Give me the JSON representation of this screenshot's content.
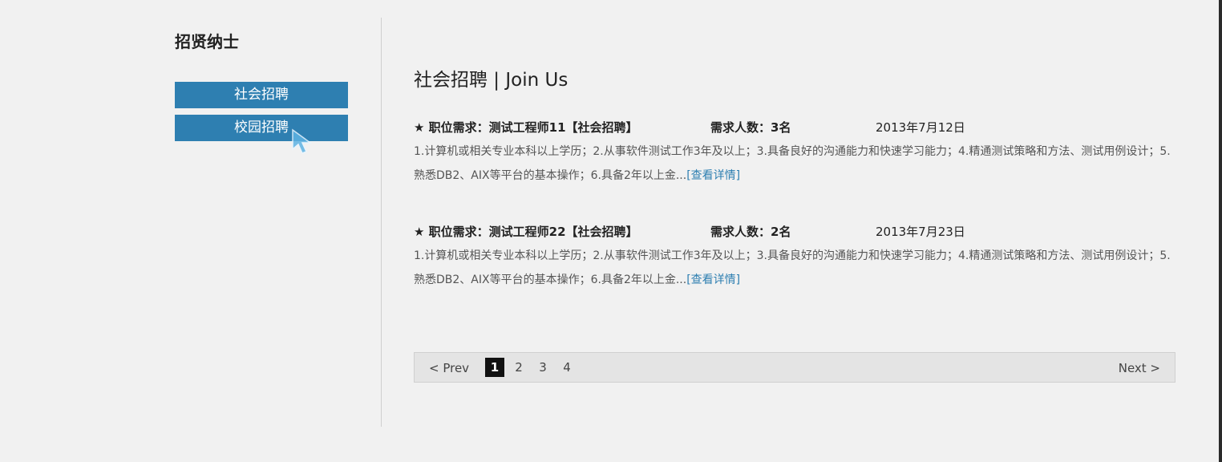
{
  "sidebar": {
    "title": "招贤纳士",
    "items": [
      {
        "label": "社会招聘"
      },
      {
        "label": "校园招聘"
      }
    ]
  },
  "main": {
    "title": "社会招聘 | Join Us",
    "jobs": [
      {
        "position": "★ 职位需求：测试工程师11【社会招聘】",
        "count": "需求人数：3名",
        "date": "2013年7月12日",
        "description": "1.计算机或相关专业本科以上学历；2.从事软件测试工作3年及以上；3.具备良好的沟通能力和快速学习能力；4.精通测试策略和方法、测试用例设计；5.熟悉DB2、AIX等平台的基本操作；6.具备2年以上金...",
        "link": "[查看详情]"
      },
      {
        "position": "★ 职位需求：测试工程师22【社会招聘】",
        "count": "需求人数：2名",
        "date": "2013年7月23日",
        "description": "1.计算机或相关专业本科以上学历；2.从事软件测试工作3年及以上；3.具备良好的沟通能力和快速学习能力；4.精通测试策略和方法、测试用例设计；5.熟悉DB2、AIX等平台的基本操作；6.具备2年以上金...",
        "link": "[查看详情]"
      }
    ]
  },
  "pager": {
    "prev": "< Prev",
    "pages": [
      "1",
      "2",
      "3",
      "4"
    ],
    "current": "1",
    "next": "Next >"
  },
  "colors": {
    "accent": "#2e7fb1",
    "background": "#f1f1f1",
    "pager_bg": "#e4e4e4",
    "active_page": "#111111"
  },
  "icons": [
    "cursor-icon"
  ]
}
